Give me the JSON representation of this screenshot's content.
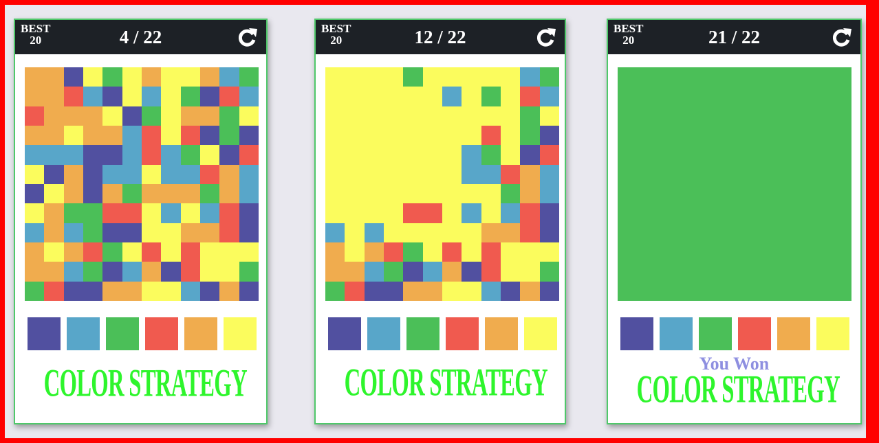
{
  "colors": {
    "P": "#5150a0",
    "B": "#58a6c9",
    "G": "#4bbf58",
    "R": "#f05a4f",
    "O": "#f0ac4e",
    "Y": "#fbfc5d"
  },
  "palette": [
    "P",
    "B",
    "G",
    "R",
    "O",
    "Y"
  ],
  "panels": [
    {
      "best_label": "BEST",
      "best": "20",
      "score": "4 / 22",
      "won": "",
      "title": "COLOR STRATEGY",
      "grid": [
        "OOPYGYOYYOBG",
        "OORBPYBYGPRB",
        "ROOOYPGYOOGY",
        "OOYOOBRYRPGP",
        "BBBPPBRBGYPR",
        "YPOPBBYBBROB",
        "PYOPOGOOOGOB",
        "YOGGRRYBYBRP",
        "BOBGPPYYOORP",
        "OYORGYRYRYYY",
        "OOBGPBOPRYYG",
        "GRPPOOYYBPOP"
      ]
    },
    {
      "best_label": "BEST",
      "best": "20",
      "score": "12 / 22",
      "won": "",
      "title": "COLOR STRATEGY",
      "grid": [
        "YYYYGYYYYYBG",
        "YYYYYYBYGYRB",
        "YYYYYYYYYYGY",
        "YYYYYYYYRYGP",
        "YYYYYYYBGYPR",
        "YYYYYYYBBROB",
        "YYYYYYYYYGOB",
        "YYYYRRYBYBRP",
        "BYBYYYYYOORP",
        "OYORGYRYRYYY",
        "OOBGPBOPRYYG",
        "GRPPOOYYBPOP"
      ]
    },
    {
      "best_label": "BEST",
      "best": "20",
      "score": "21 / 22",
      "won": "You Won",
      "title": "COLOR STRATEGY",
      "grid": [
        "GGGGGGGGGGGG",
        "GGGGGGGGGGGG",
        "GGGGGGGGGGGG",
        "GGGGGGGGGGGG",
        "GGGGGGGGGGGG",
        "GGGGGGGGGGGG",
        "GGGGGGGGGGGG",
        "GGGGGGGGGGGG",
        "GGGGGGGGGGGG",
        "GGGGGGGGGGGG",
        "GGGGGGGGGGGG",
        "GGGGGGGGGGGG"
      ]
    }
  ]
}
